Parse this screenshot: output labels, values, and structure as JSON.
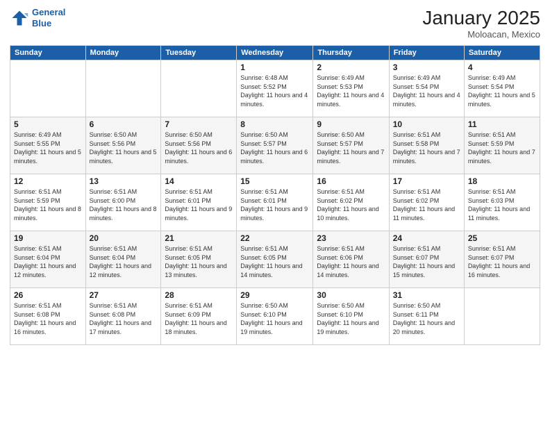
{
  "header": {
    "logo_line1": "General",
    "logo_line2": "Blue",
    "month_title": "January 2025",
    "location": "Moloacan, Mexico"
  },
  "weekdays": [
    "Sunday",
    "Monday",
    "Tuesday",
    "Wednesday",
    "Thursday",
    "Friday",
    "Saturday"
  ],
  "weeks": [
    [
      {
        "num": "",
        "info": ""
      },
      {
        "num": "",
        "info": ""
      },
      {
        "num": "",
        "info": ""
      },
      {
        "num": "1",
        "info": "Sunrise: 6:48 AM\nSunset: 5:52 PM\nDaylight: 11 hours and 4 minutes."
      },
      {
        "num": "2",
        "info": "Sunrise: 6:49 AM\nSunset: 5:53 PM\nDaylight: 11 hours and 4 minutes."
      },
      {
        "num": "3",
        "info": "Sunrise: 6:49 AM\nSunset: 5:54 PM\nDaylight: 11 hours and 4 minutes."
      },
      {
        "num": "4",
        "info": "Sunrise: 6:49 AM\nSunset: 5:54 PM\nDaylight: 11 hours and 5 minutes."
      }
    ],
    [
      {
        "num": "5",
        "info": "Sunrise: 6:49 AM\nSunset: 5:55 PM\nDaylight: 11 hours and 5 minutes."
      },
      {
        "num": "6",
        "info": "Sunrise: 6:50 AM\nSunset: 5:56 PM\nDaylight: 11 hours and 5 minutes."
      },
      {
        "num": "7",
        "info": "Sunrise: 6:50 AM\nSunset: 5:56 PM\nDaylight: 11 hours and 6 minutes."
      },
      {
        "num": "8",
        "info": "Sunrise: 6:50 AM\nSunset: 5:57 PM\nDaylight: 11 hours and 6 minutes."
      },
      {
        "num": "9",
        "info": "Sunrise: 6:50 AM\nSunset: 5:57 PM\nDaylight: 11 hours and 7 minutes."
      },
      {
        "num": "10",
        "info": "Sunrise: 6:51 AM\nSunset: 5:58 PM\nDaylight: 11 hours and 7 minutes."
      },
      {
        "num": "11",
        "info": "Sunrise: 6:51 AM\nSunset: 5:59 PM\nDaylight: 11 hours and 7 minutes."
      }
    ],
    [
      {
        "num": "12",
        "info": "Sunrise: 6:51 AM\nSunset: 5:59 PM\nDaylight: 11 hours and 8 minutes."
      },
      {
        "num": "13",
        "info": "Sunrise: 6:51 AM\nSunset: 6:00 PM\nDaylight: 11 hours and 8 minutes."
      },
      {
        "num": "14",
        "info": "Sunrise: 6:51 AM\nSunset: 6:01 PM\nDaylight: 11 hours and 9 minutes."
      },
      {
        "num": "15",
        "info": "Sunrise: 6:51 AM\nSunset: 6:01 PM\nDaylight: 11 hours and 9 minutes."
      },
      {
        "num": "16",
        "info": "Sunrise: 6:51 AM\nSunset: 6:02 PM\nDaylight: 11 hours and 10 minutes."
      },
      {
        "num": "17",
        "info": "Sunrise: 6:51 AM\nSunset: 6:02 PM\nDaylight: 11 hours and 11 minutes."
      },
      {
        "num": "18",
        "info": "Sunrise: 6:51 AM\nSunset: 6:03 PM\nDaylight: 11 hours and 11 minutes."
      }
    ],
    [
      {
        "num": "19",
        "info": "Sunrise: 6:51 AM\nSunset: 6:04 PM\nDaylight: 11 hours and 12 minutes."
      },
      {
        "num": "20",
        "info": "Sunrise: 6:51 AM\nSunset: 6:04 PM\nDaylight: 11 hours and 12 minutes."
      },
      {
        "num": "21",
        "info": "Sunrise: 6:51 AM\nSunset: 6:05 PM\nDaylight: 11 hours and 13 minutes."
      },
      {
        "num": "22",
        "info": "Sunrise: 6:51 AM\nSunset: 6:05 PM\nDaylight: 11 hours and 14 minutes."
      },
      {
        "num": "23",
        "info": "Sunrise: 6:51 AM\nSunset: 6:06 PM\nDaylight: 11 hours and 14 minutes."
      },
      {
        "num": "24",
        "info": "Sunrise: 6:51 AM\nSunset: 6:07 PM\nDaylight: 11 hours and 15 minutes."
      },
      {
        "num": "25",
        "info": "Sunrise: 6:51 AM\nSunset: 6:07 PM\nDaylight: 11 hours and 16 minutes."
      }
    ],
    [
      {
        "num": "26",
        "info": "Sunrise: 6:51 AM\nSunset: 6:08 PM\nDaylight: 11 hours and 16 minutes."
      },
      {
        "num": "27",
        "info": "Sunrise: 6:51 AM\nSunset: 6:08 PM\nDaylight: 11 hours and 17 minutes."
      },
      {
        "num": "28",
        "info": "Sunrise: 6:51 AM\nSunset: 6:09 PM\nDaylight: 11 hours and 18 minutes."
      },
      {
        "num": "29",
        "info": "Sunrise: 6:50 AM\nSunset: 6:10 PM\nDaylight: 11 hours and 19 minutes."
      },
      {
        "num": "30",
        "info": "Sunrise: 6:50 AM\nSunset: 6:10 PM\nDaylight: 11 hours and 19 minutes."
      },
      {
        "num": "31",
        "info": "Sunrise: 6:50 AM\nSunset: 6:11 PM\nDaylight: 11 hours and 20 minutes."
      },
      {
        "num": "",
        "info": ""
      }
    ]
  ]
}
